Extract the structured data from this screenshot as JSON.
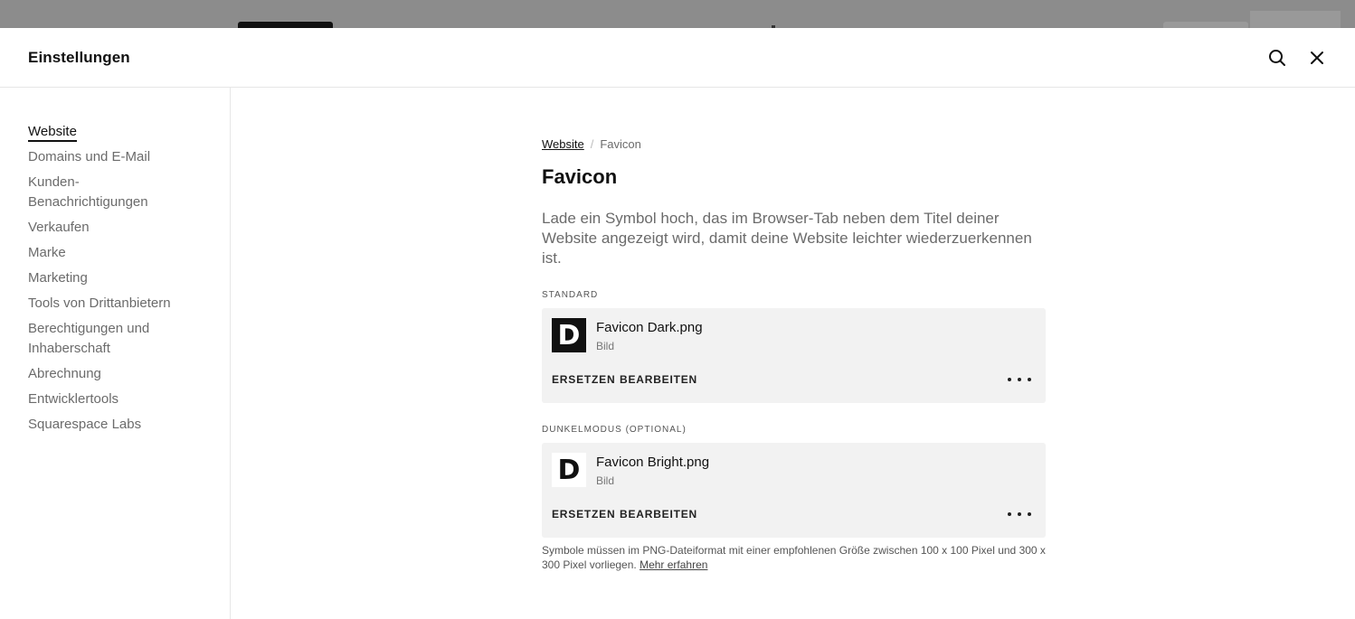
{
  "header": {
    "title": "Einstellungen",
    "search_icon": "search-icon",
    "close_icon": "close-icon"
  },
  "sidebar": {
    "items": [
      {
        "label": "Website",
        "active": true
      },
      {
        "label": "Domains und E-Mail"
      },
      {
        "label": "Kunden-\nBenachrichtigungen"
      },
      {
        "label": "Verkaufen"
      },
      {
        "label": "Marke"
      },
      {
        "label": "Marketing"
      },
      {
        "label": "Tools von Drittanbietern"
      },
      {
        "label": "Berechtigungen und\nInhaberschaft"
      },
      {
        "label": "Abrechnung"
      },
      {
        "label": "Entwicklertools"
      },
      {
        "label": "Squarespace Labs"
      }
    ]
  },
  "breadcrumb": {
    "parent": "Website",
    "separator": "/",
    "current": "Favicon"
  },
  "page": {
    "title": "Favicon",
    "description": "Lade ein Symbol hoch, das im Browser-Tab neben dem Titel deiner Website angezeigt wird, damit deine Website leichter wiederzuerkennen ist."
  },
  "standard": {
    "label": "STANDARD",
    "thumb_letter": "D",
    "file_name": "Favicon Dark.png",
    "file_type": "Bild",
    "replace_label": "ERSETZEN",
    "edit_label": "BEARBEITEN"
  },
  "dark_mode": {
    "label": "DUNKELMODUS (OPTIONAL)",
    "thumb_letter": "D",
    "file_name": "Favicon Bright.png",
    "file_type": "Bild",
    "replace_label": "ERSETZEN",
    "edit_label": "BEARBEITEN"
  },
  "note": {
    "text": "Symbole müssen im PNG-Dateiformat mit einer empfohlenen Größe zwischen 100 x 100 Pixel und 300 x 300 Pixel vorliegen.",
    "link": "Mehr erfahren"
  },
  "colors": {
    "accent": "#111111",
    "muted_text": "#6b6b6b",
    "card_bg": "#f2f2f2"
  }
}
